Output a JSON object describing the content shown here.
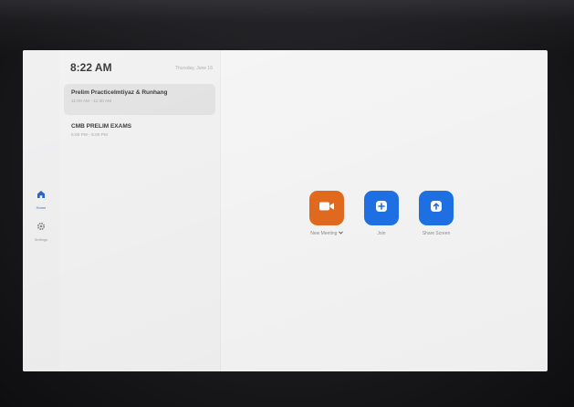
{
  "nav": {
    "items": [
      {
        "label": "Home",
        "icon": "home-icon",
        "active": true
      },
      {
        "label": "Settings",
        "icon": "gear-icon",
        "active": false
      }
    ]
  },
  "header": {
    "time": "8:22 AM",
    "date": "Thursday, June 16"
  },
  "meetings": [
    {
      "title": "Prelim PracticeImtiyaz & Runhang",
      "time": "11:00 AM - 11:30 AM",
      "selected": true
    },
    {
      "title": "CMB PRELIM EXAMS",
      "time": "5:00 PM - 5:00 PM",
      "selected": false
    }
  ],
  "actions": {
    "new_meeting": {
      "label": "New Meeting",
      "icon": "video-camera-icon",
      "color": "#e36b1e"
    },
    "join": {
      "label": "Join",
      "icon": "plus-icon",
      "color": "#1f72e6"
    },
    "share_screen": {
      "label": "Share Screen",
      "icon": "upload-arrow-icon",
      "color": "#1f72e6"
    }
  }
}
